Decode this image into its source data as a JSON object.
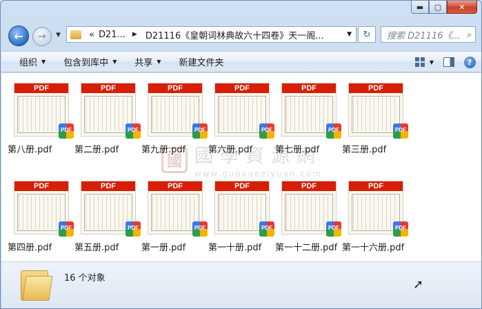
{
  "window": {
    "caption_min": "▬",
    "caption_max": "▢",
    "caption_close": "✕"
  },
  "nav": {
    "back_icon": "←",
    "forward_icon": "→",
    "breadcrumb_chevron": "«",
    "breadcrumb": [
      "D21...",
      "D21116《皇朝词林典故六十四卷》天一阁..."
    ],
    "search_placeholder": "搜索 D21116《...",
    "refresh_icon": "↻",
    "search_icon": "🔍"
  },
  "toolbar": {
    "organize": "组织",
    "include_library": "包含到库中",
    "share": "共享",
    "new_folder": "新建文件夹"
  },
  "watermark": {
    "seal": "國",
    "chinese": "國學資源網",
    "url": "www.guoxueziyuan.com"
  },
  "files": [
    {
      "name": "第八册.pdf",
      "band": "PDF",
      "badge": "PDF"
    },
    {
      "name": "第二册.pdf",
      "band": "PDF",
      "badge": "PDF"
    },
    {
      "name": "第九册.pdf",
      "band": "PDF",
      "badge": "PDF"
    },
    {
      "name": "第六册.pdf",
      "band": "PDF",
      "badge": "PDF"
    },
    {
      "name": "第七册.pdf",
      "band": "PDF",
      "badge": "PDF"
    },
    {
      "name": "第三册.pdf",
      "band": "PDF",
      "badge": "PDF"
    },
    {
      "name": "第四册.pdf",
      "band": "PDF",
      "badge": "PDF"
    },
    {
      "name": "第五册.pdf",
      "band": "PDF",
      "badge": "PDF"
    },
    {
      "name": "第一册.pdf",
      "band": "PDF",
      "badge": "PDF"
    },
    {
      "name": "第一十册.pdf",
      "band": "PDF",
      "badge": "PDF"
    },
    {
      "name": "第一十二册.pdf",
      "band": "PDF",
      "badge": "PDF"
    },
    {
      "name": "第一十六册.pdf",
      "band": "PDF",
      "badge": "PDF"
    }
  ],
  "status": {
    "count_text": "16 个对象"
  },
  "colors": {
    "pdf_band": "#d81e06",
    "window_frame": "#b9d1ec",
    "close_button": "#c8432b"
  }
}
